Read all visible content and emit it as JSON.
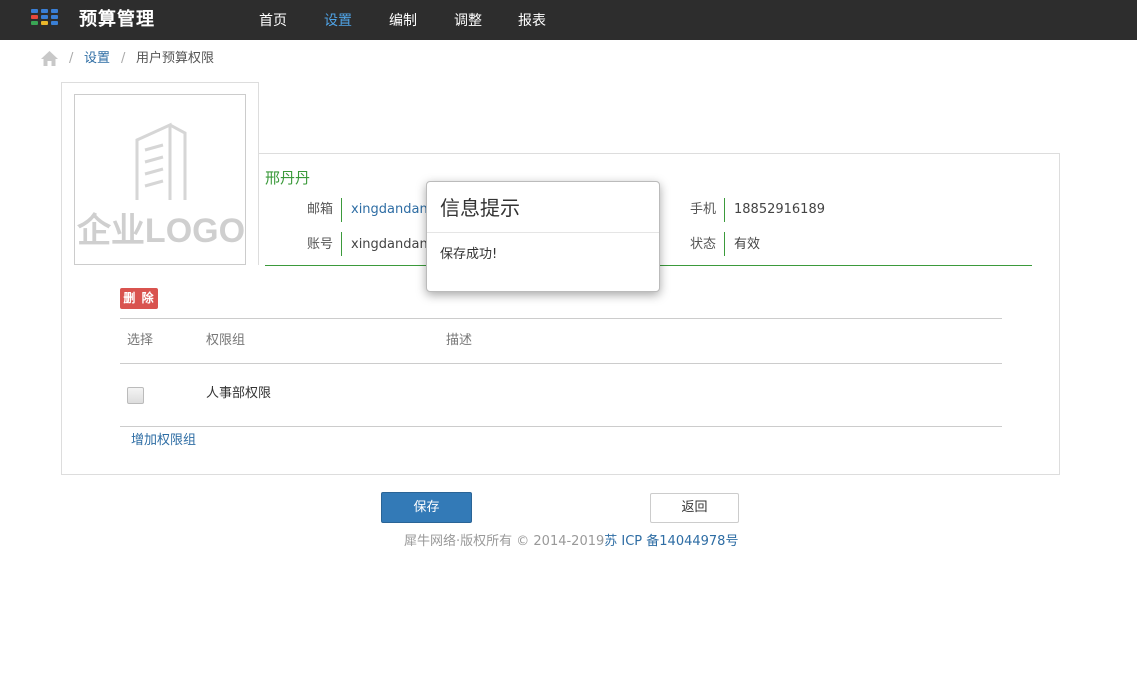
{
  "header": {
    "brand": "预算管理",
    "nav": [
      {
        "label": "首页",
        "active": false
      },
      {
        "label": "设置",
        "active": true
      },
      {
        "label": "编制",
        "active": false
      },
      {
        "label": "调整",
        "active": false
      },
      {
        "label": "报表",
        "active": false
      }
    ]
  },
  "breadcrumb": {
    "sep": "/",
    "items": [
      "设置",
      "用户预算权限"
    ]
  },
  "logo": {
    "text": "企业LOGO"
  },
  "user": {
    "name": "邢丹丹",
    "email_label": "邮箱",
    "email_value": "xingdandan@",
    "account_label": "账号",
    "account_value": "xingdandan",
    "phone_label": "手机",
    "phone_value": "18852916189",
    "status_label": "状态",
    "status_value": "有效"
  },
  "actions": {
    "delete_label": "删 除",
    "add_group_label": "增加权限组",
    "save_label": "保存",
    "back_label": "返回"
  },
  "table": {
    "headers": [
      "选择",
      "权限组",
      "描述"
    ],
    "rows": [
      {
        "group": "人事部权限",
        "description": "",
        "checked": false
      }
    ]
  },
  "footer": {
    "text": "犀牛网络·版权所有 © 2014-2019",
    "icp": "苏 ICP 备14044978号"
  },
  "modal": {
    "title": "信息提示",
    "message": "保存成功!"
  },
  "colors": {
    "topbar": "#2d2d2d",
    "nav_active": "#4fa3e6",
    "link": "#2e6da4",
    "accent_green": "#3b9a3b",
    "danger": "#d9534f",
    "primary": "#337ab7"
  }
}
